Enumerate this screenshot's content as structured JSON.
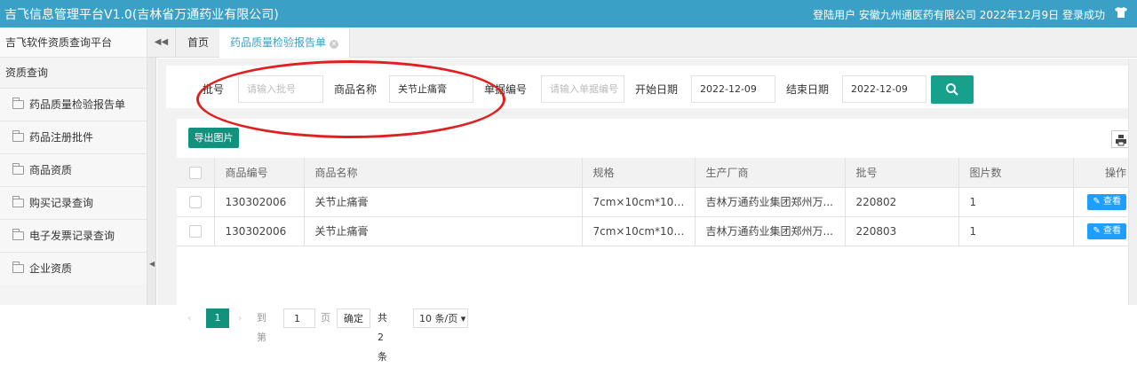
{
  "header": {
    "title": "吉飞信息管理平台V1.0(吉林省万通药业有限公司)",
    "user_status": "登陆用户 安徽九州通医药有限公司 2022年12月9日 登录成功",
    "user_icon": "shirt-icon"
  },
  "sidebar": {
    "header": "吉飞软件资质查询平台",
    "group": "资质查询",
    "items": [
      {
        "label": "药品质量检验报告单"
      },
      {
        "label": "药品注册批件"
      },
      {
        "label": "商品资质"
      },
      {
        "label": "购买记录查询"
      },
      {
        "label": "电子发票记录查询"
      },
      {
        "label": "企业资质"
      }
    ]
  },
  "tabs": [
    {
      "label": "首页"
    },
    {
      "label": "药品质量检验报告单"
    }
  ],
  "search": {
    "batch_label": "批号",
    "batch_placeholder": "请输入批号",
    "product_label": "商品名称",
    "product_value": "关节止痛膏",
    "doc_label": "单据编号",
    "doc_placeholder": "请输入单据编号",
    "start_label": "开始日期",
    "start_value": "2022-12-09",
    "end_label": "结束日期",
    "end_value": "2022-12-09"
  },
  "toolbar": {
    "export_label": "导出图片"
  },
  "table": {
    "columns": [
      "商品编号",
      "商品名称",
      "规格",
      "生产厂商",
      "批号",
      "图片数",
      "操作"
    ],
    "rows": [
      {
        "code": "130302006",
        "name": "关节止痛膏",
        "spec": "7cm×10cm*10贴...",
        "maker": "吉林万通药业集团郑州万...",
        "batch": "220802",
        "count": "1",
        "action": "查看"
      },
      {
        "code": "130302006",
        "name": "关节止痛膏",
        "spec": "7cm×10cm*10贴...",
        "maker": "吉林万通药业集团郑州万...",
        "batch": "220803",
        "count": "1",
        "action": "查看"
      }
    ]
  },
  "pager": {
    "current": "1",
    "goto_label": "到第",
    "goto_value": "1",
    "page_label": "页",
    "confirm": "确定",
    "total": "共 2 条",
    "page_size": "10 条/页"
  },
  "colors": {
    "header_bg": "#3ba0c6",
    "primary": "#12917c",
    "view_button": "#1e9fff",
    "annotation": "#e02020"
  }
}
